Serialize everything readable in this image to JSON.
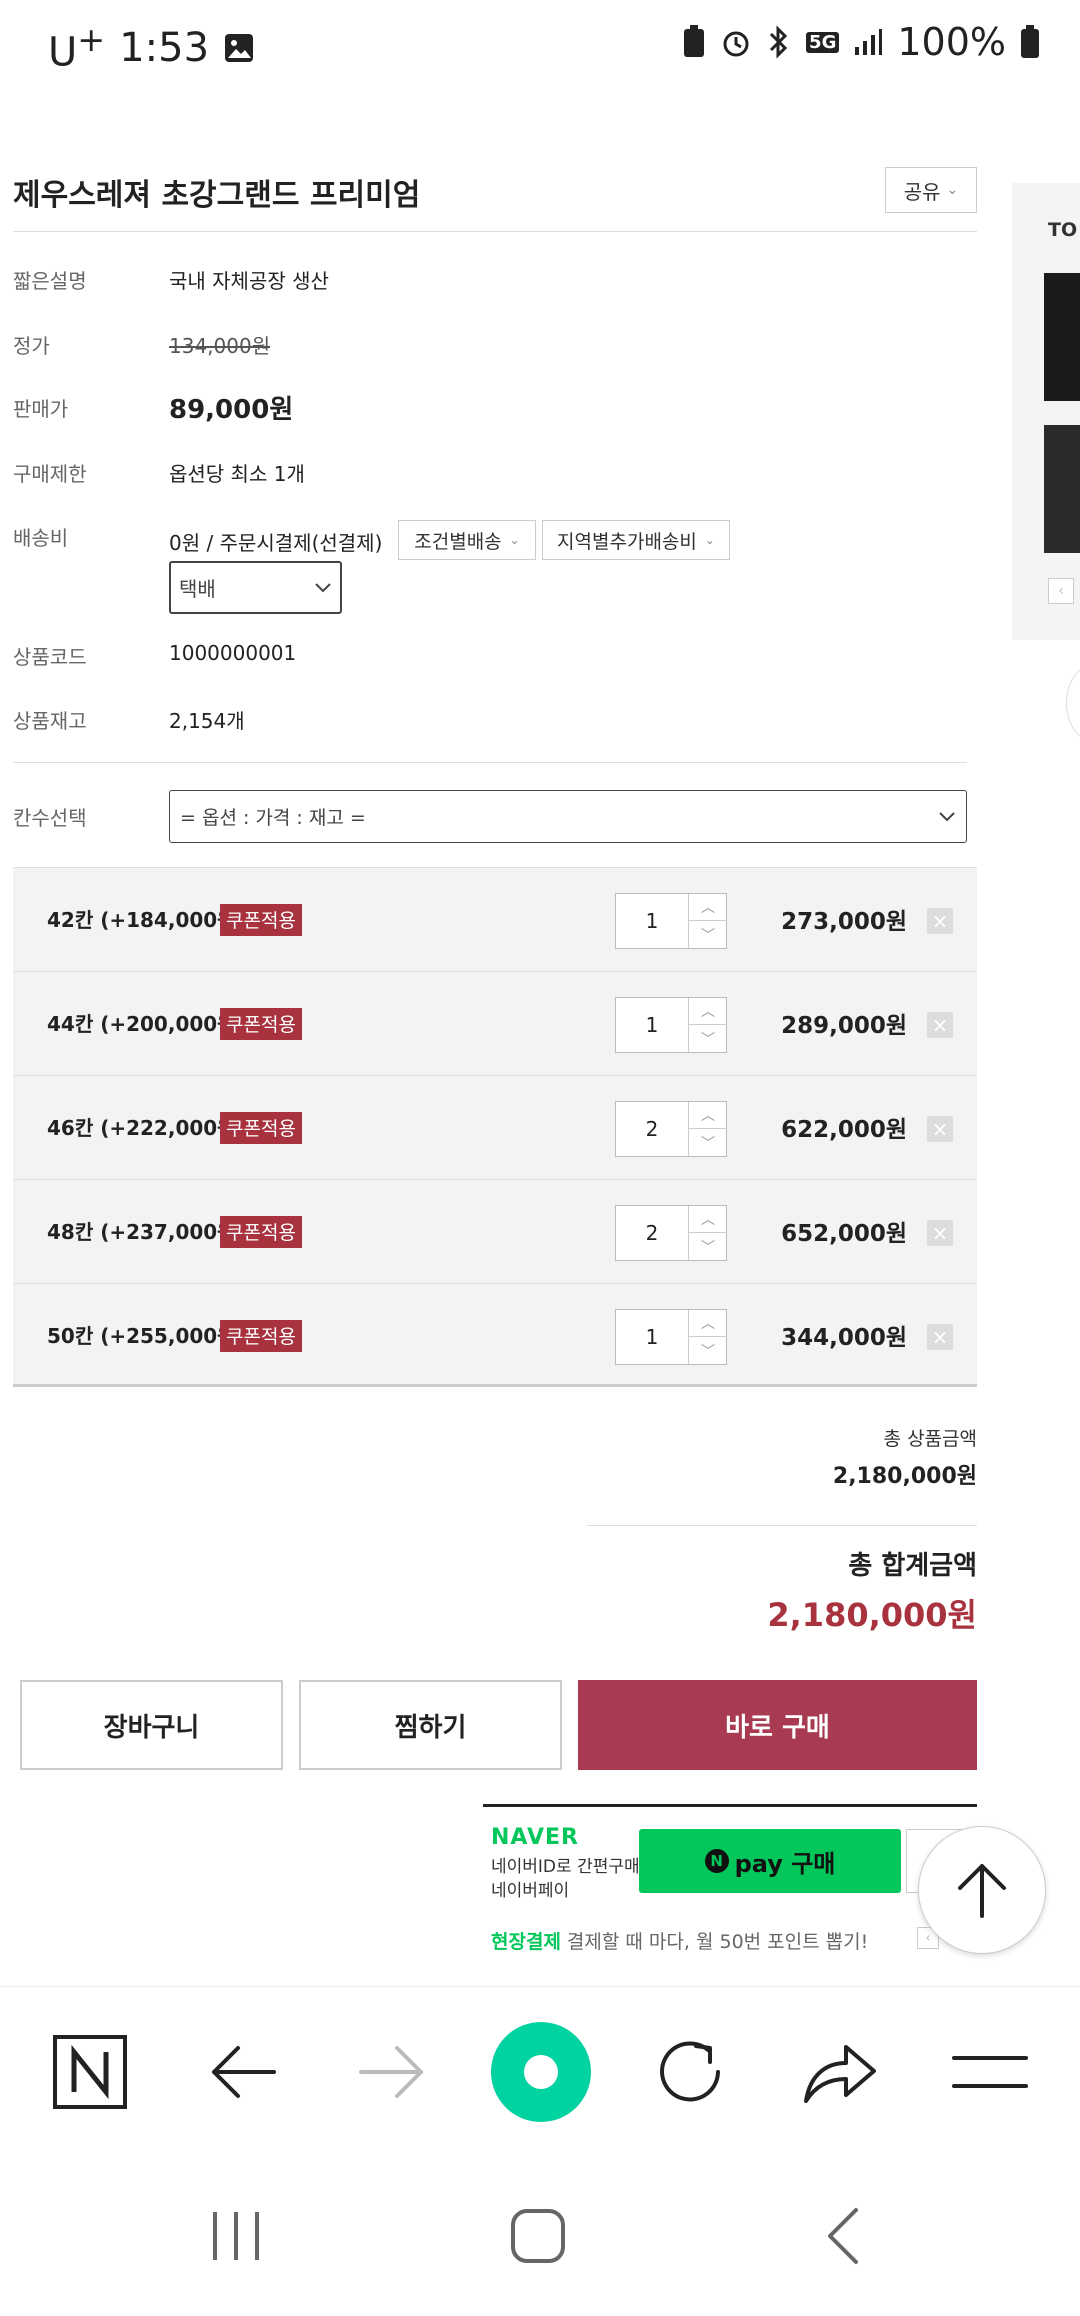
{
  "status_bar": {
    "carrier": "U",
    "carrier_sup": "+",
    "time": "1:53",
    "network": "5G",
    "battery": "100%"
  },
  "product": {
    "title": "제우스레져 초강그랜드 프리미엄",
    "share_label": "공유",
    "rows": [
      {
        "label": "짧은설명",
        "value": "국내 자체공장 생산"
      },
      {
        "label": "정가",
        "value": "134,000원"
      },
      {
        "label": "판매가",
        "value": "89,000원"
      },
      {
        "label": "구매제한",
        "value": "옵션당 최소 1개"
      },
      {
        "label": "배송비",
        "value": "0원  / 주문시결제(선결제)"
      },
      {
        "label": "상품코드",
        "value": "1000000001"
      },
      {
        "label": "상품재고",
        "value": "2,154개"
      }
    ],
    "shipping_buttons": [
      "조건별배송",
      "지역별추가배송비"
    ],
    "shipping_method": "택배"
  },
  "options": {
    "label": "칸수선택",
    "select_value": "= 옵션 : 가격 : 재고 =",
    "coupon_label": "쿠폰적용",
    "items": [
      {
        "name": "42칸 (+184,000원)",
        "qty": "1",
        "price": "273,000원"
      },
      {
        "name": "44칸 (+200,000원)",
        "qty": "1",
        "price": "289,000원"
      },
      {
        "name": "46칸 (+222,000원)",
        "qty": "2",
        "price": "622,000원"
      },
      {
        "name": "48칸 (+237,000원)",
        "qty": "2",
        "price": "652,000원"
      },
      {
        "name": "50칸 (+255,000원)",
        "qty": "1",
        "price": "344,000원"
      }
    ]
  },
  "summary": {
    "subtotal_label": "총 상품금액",
    "subtotal_value": "2,180,000원",
    "total_label": "총 합계금액",
    "total_value": "2,180,000원"
  },
  "actions": {
    "cart": "장바구니",
    "wishlist": "찜하기",
    "buy_now": "바로 구매"
  },
  "naver": {
    "logo": "NAVER",
    "desc_line1": "네이버ID로 간편구매",
    "desc_line2": "네이버페이",
    "npay_label": "pay 구매",
    "onsite_label": "현장결제",
    "onsite_text": "결제할 때 마다, 월 50번 포인트 뽑기!"
  },
  "side_panel": {
    "label": "TO"
  },
  "colors": {
    "accent": "#a83b51",
    "coupon": "#a8333f",
    "naver_green": "#03c75a",
    "whale_green": "#00d2a0"
  }
}
